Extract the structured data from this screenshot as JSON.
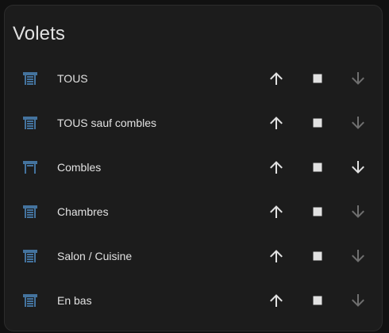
{
  "card": {
    "title": "Volets"
  },
  "colors": {
    "card_bg": "#1c1c1c",
    "text": "#e1e1e1",
    "icon_blue": "#44739e",
    "button_active": "#e1e1e1",
    "button_disabled": "#6f6f6f"
  },
  "rows": [
    {
      "name": "TOUS",
      "icon": "window-shutter-closed-icon",
      "down_enabled": false
    },
    {
      "name": "TOUS sauf combles",
      "icon": "window-shutter-closed-icon",
      "down_enabled": false
    },
    {
      "name": "Combles",
      "icon": "window-shutter-open-icon",
      "down_enabled": true
    },
    {
      "name": "Chambres",
      "icon": "window-shutter-closed-icon",
      "down_enabled": false
    },
    {
      "name": "Salon / Cuisine",
      "icon": "window-shutter-closed-icon",
      "down_enabled": false
    },
    {
      "name": "En bas",
      "icon": "window-shutter-closed-icon",
      "down_enabled": false
    }
  ],
  "controls": {
    "up_icon": "arrow-up-icon",
    "stop_icon": "stop-icon",
    "down_icon": "arrow-down-icon"
  }
}
